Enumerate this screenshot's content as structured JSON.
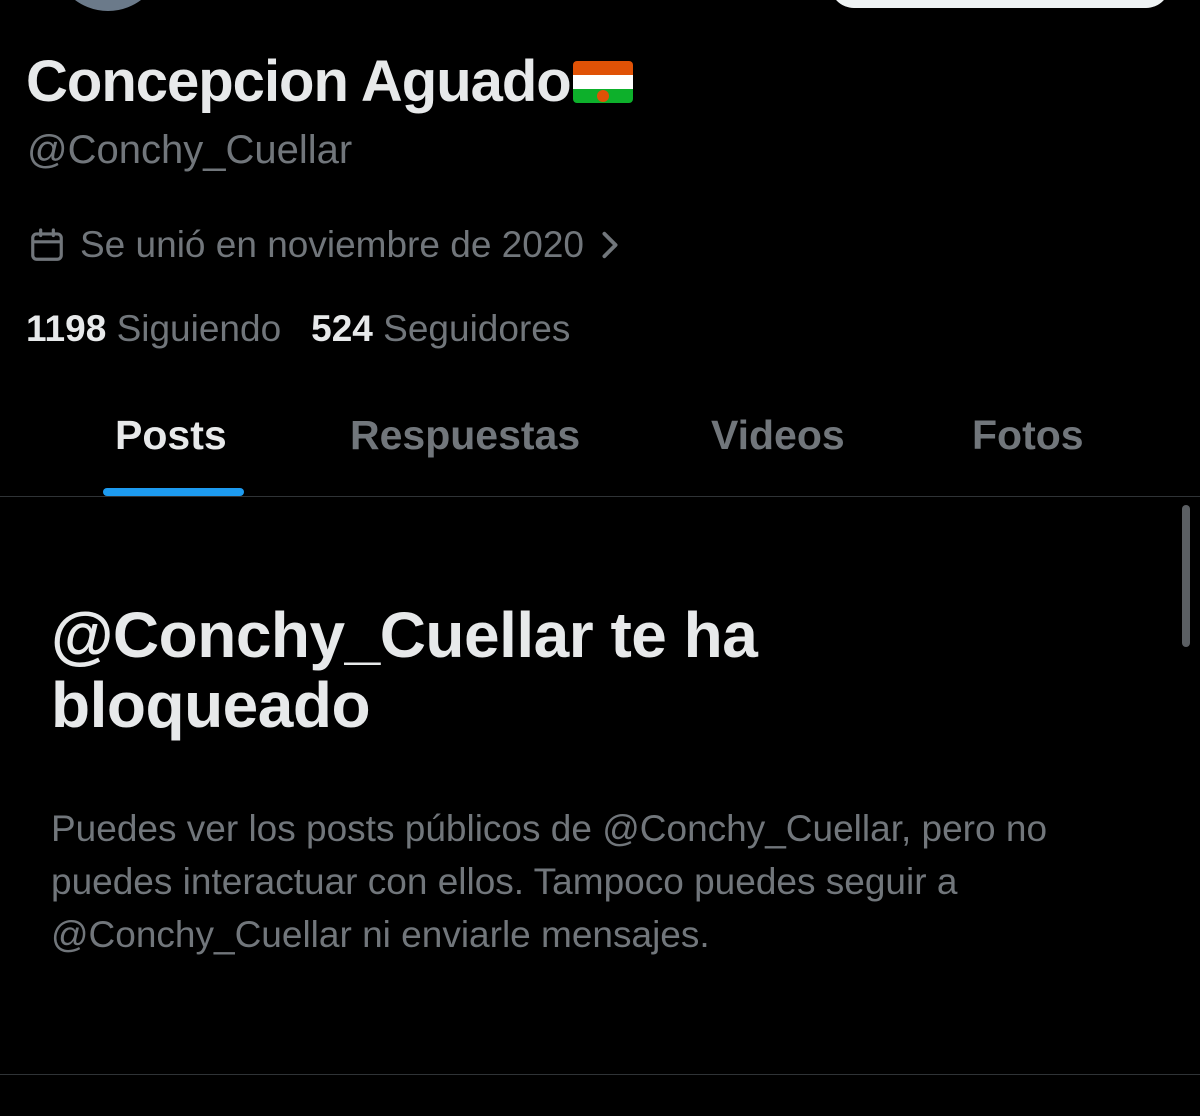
{
  "profile": {
    "display_name": "Concepcion Aguado",
    "flag_emoji": "niger-flag-icon",
    "handle": "@Conchy_Cuellar",
    "joined": "Se unió en noviembre de 2020",
    "following_count": "1198",
    "following_label": "Siguiendo",
    "followers_count": "524",
    "followers_label": "Seguidores"
  },
  "tabs": [
    {
      "label": "Posts",
      "active": true
    },
    {
      "label": "Respuestas",
      "active": false
    },
    {
      "label": "Videos",
      "active": false
    },
    {
      "label": "Fotos",
      "active": false
    }
  ],
  "blocked": {
    "title": "@Conchy_Cuellar te ha bloqueado",
    "description": "Puedes ver los posts públicos de @Conchy_Cuellar, pero no puedes interactuar con ellos. Tampoco puedes seguir a @Conchy_Cuellar ni enviarle mensajes."
  },
  "colors": {
    "background": "#000000",
    "primary_text": "#e7e9ea",
    "secondary_text": "#71767b",
    "accent": "#1d9bf0",
    "divider": "#2f3336"
  }
}
